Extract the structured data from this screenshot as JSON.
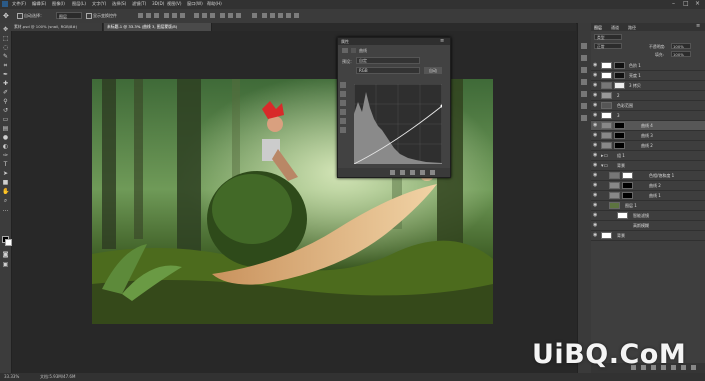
{
  "menubar": {
    "items": [
      "文件(F)",
      "编辑(E)",
      "图像(I)",
      "图层(L)",
      "文字(Y)",
      "选择(S)",
      "滤镜(T)",
      "3D(D)",
      "视图(V)",
      "窗口(W)",
      "帮助(H)"
    ]
  },
  "options_bar": {
    "auto_select_label": "自动选择：",
    "auto_select_value": "图层",
    "show_transform_label": "显示变换控件"
  },
  "tabs": [
    {
      "label": "素材.psd @ 100% (snail, RGB/8#)"
    },
    {
      "label": "未标题-1 @ 33.3% (曲线 3, 图层蒙版/8)"
    }
  ],
  "properties_panel": {
    "title": "属性",
    "adjustment_label": "曲线",
    "preset_label": "预设：",
    "preset_value": "自定",
    "channel_value": "RGB",
    "auto_button": "自动"
  },
  "layers_panel": {
    "tabs": [
      "图层",
      "通道",
      "路径"
    ],
    "kind_label": "类型",
    "blend_mode": "正常",
    "opacity_label": "不透明度:",
    "opacity_value": "100%",
    "fill_label": "填充:",
    "fill_value": "100%",
    "layers": [
      {
        "name": "色阶 1",
        "selected": false
      },
      {
        "name": "亮度 1",
        "selected": false
      },
      {
        "name": "3 拷贝",
        "selected": false
      },
      {
        "name": "2",
        "selected": false
      },
      {
        "name": "色彩范围",
        "selected": false
      },
      {
        "name": "3",
        "selected": false
      },
      {
        "name": "曲线 4",
        "selected": true
      },
      {
        "name": "曲线 3",
        "selected": false
      },
      {
        "name": "曲线 2",
        "selected": false
      },
      {
        "name": "组 1",
        "selected": false
      },
      {
        "name": "背景",
        "selected": false
      },
      {
        "name": "色相/饱和度 1",
        "selected": false
      },
      {
        "name": "曲线 2",
        "selected": false
      },
      {
        "name": "曲线 1",
        "selected": false
      },
      {
        "name": "图层 1",
        "selected": false
      },
      {
        "name": "智能滤镜",
        "selected": false
      },
      {
        "name": "高斯模糊",
        "selected": false
      },
      {
        "name": "背景",
        "selected": false
      }
    ]
  },
  "status_bar": {
    "zoom": "33.33%",
    "doc_info": "文档:5.93M/47.6M"
  },
  "watermark": "UiBQ.CoM"
}
